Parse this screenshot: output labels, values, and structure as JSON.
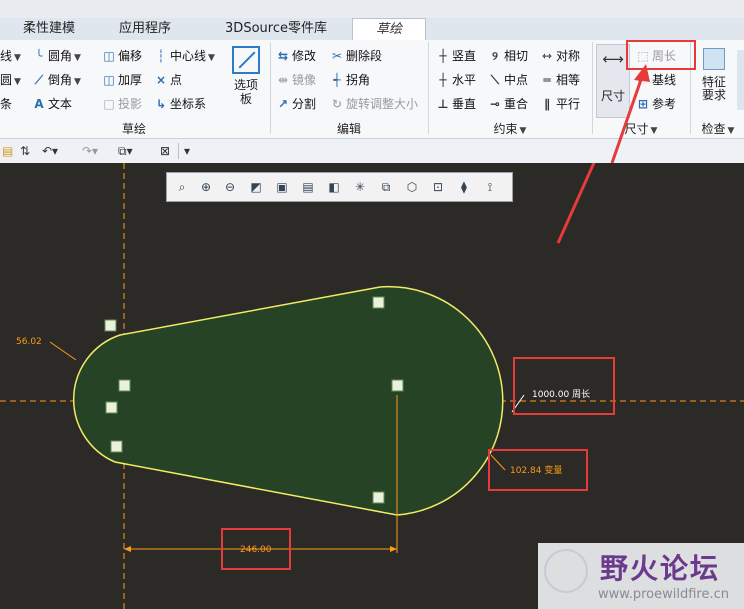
{
  "tabs": [
    "柔性建模",
    "应用程序",
    "3DSource零件库",
    "草绘"
  ],
  "ribbon": {
    "sketch_group": {
      "label": "草绘",
      "left_col": [
        "线",
        "圆",
        "条"
      ],
      "col2": [
        "圆角",
        "倒角",
        "文本"
      ],
      "col3": [
        "偏移",
        "加厚",
        "投影"
      ],
      "col4": [
        "中心线",
        "点",
        "坐标系"
      ],
      "palette_label": "选项板"
    },
    "edit_group": {
      "label": "编辑",
      "col1": [
        "修改",
        "镜像",
        "分割"
      ],
      "col2": [
        "删除段",
        "拐角",
        "旋转调整大小"
      ]
    },
    "constrain_group": {
      "label": "约束",
      "col1": [
        "竖直",
        "水平",
        "垂直"
      ],
      "col2": [
        "相切",
        "中点",
        "重合"
      ],
      "col3": [
        "对称",
        "相等",
        "平行"
      ]
    },
    "dimension_group": {
      "label": "尺寸",
      "big_button": "尺寸",
      "items": [
        "周长",
        "基线",
        "参考"
      ]
    },
    "inspect_group": {
      "label": "检查",
      "big_button": "特征要求"
    }
  },
  "qat": [
    "▾"
  ],
  "sketch": {
    "dim_left": "56.02",
    "dim_perimeter": "1000.00 周长",
    "dim_variable": "102.84 变量",
    "dim_bottom": "246.00"
  },
  "watermark": {
    "title": "野火论坛",
    "url": "www.proewildfire.cn"
  },
  "colors": {
    "canvas": "#2b2a26",
    "sketch_fill": "#274325",
    "sketch_stroke": "#f0ec66",
    "dimension": "#ff9a1a",
    "highlight": "#e53b3b"
  }
}
